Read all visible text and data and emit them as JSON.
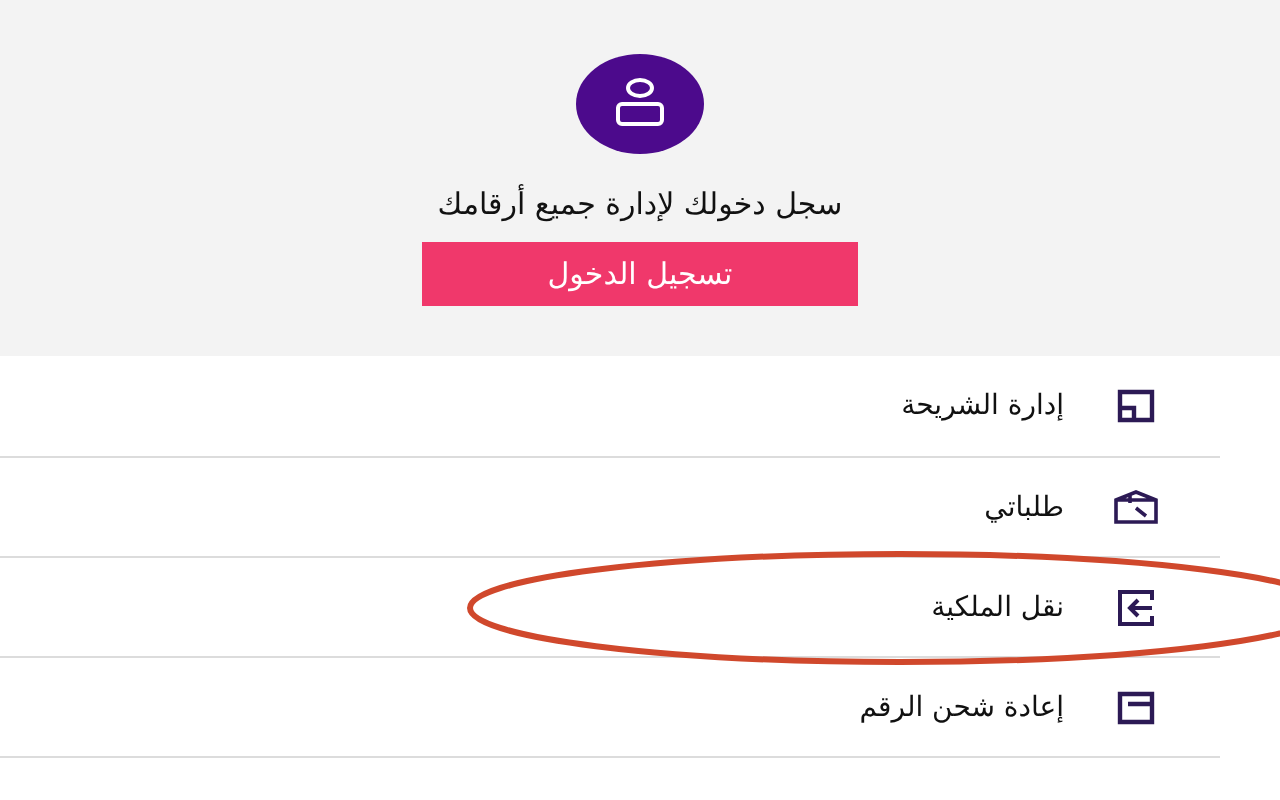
{
  "login_panel": {
    "prompt": "سجل دخولك لإدارة جميع أرقامك",
    "button": "تسجيل الدخول"
  },
  "menu": {
    "items": [
      {
        "label": "إدارة الشريحة",
        "kind": "sim",
        "circled": false
      },
      {
        "label": "طلباتي",
        "kind": "box",
        "circled": false
      },
      {
        "label": "نقل الملكية",
        "kind": "transfer",
        "circled": true
      },
      {
        "label": "إعادة شحن الرقم",
        "kind": "recharge",
        "circled": false
      }
    ]
  }
}
